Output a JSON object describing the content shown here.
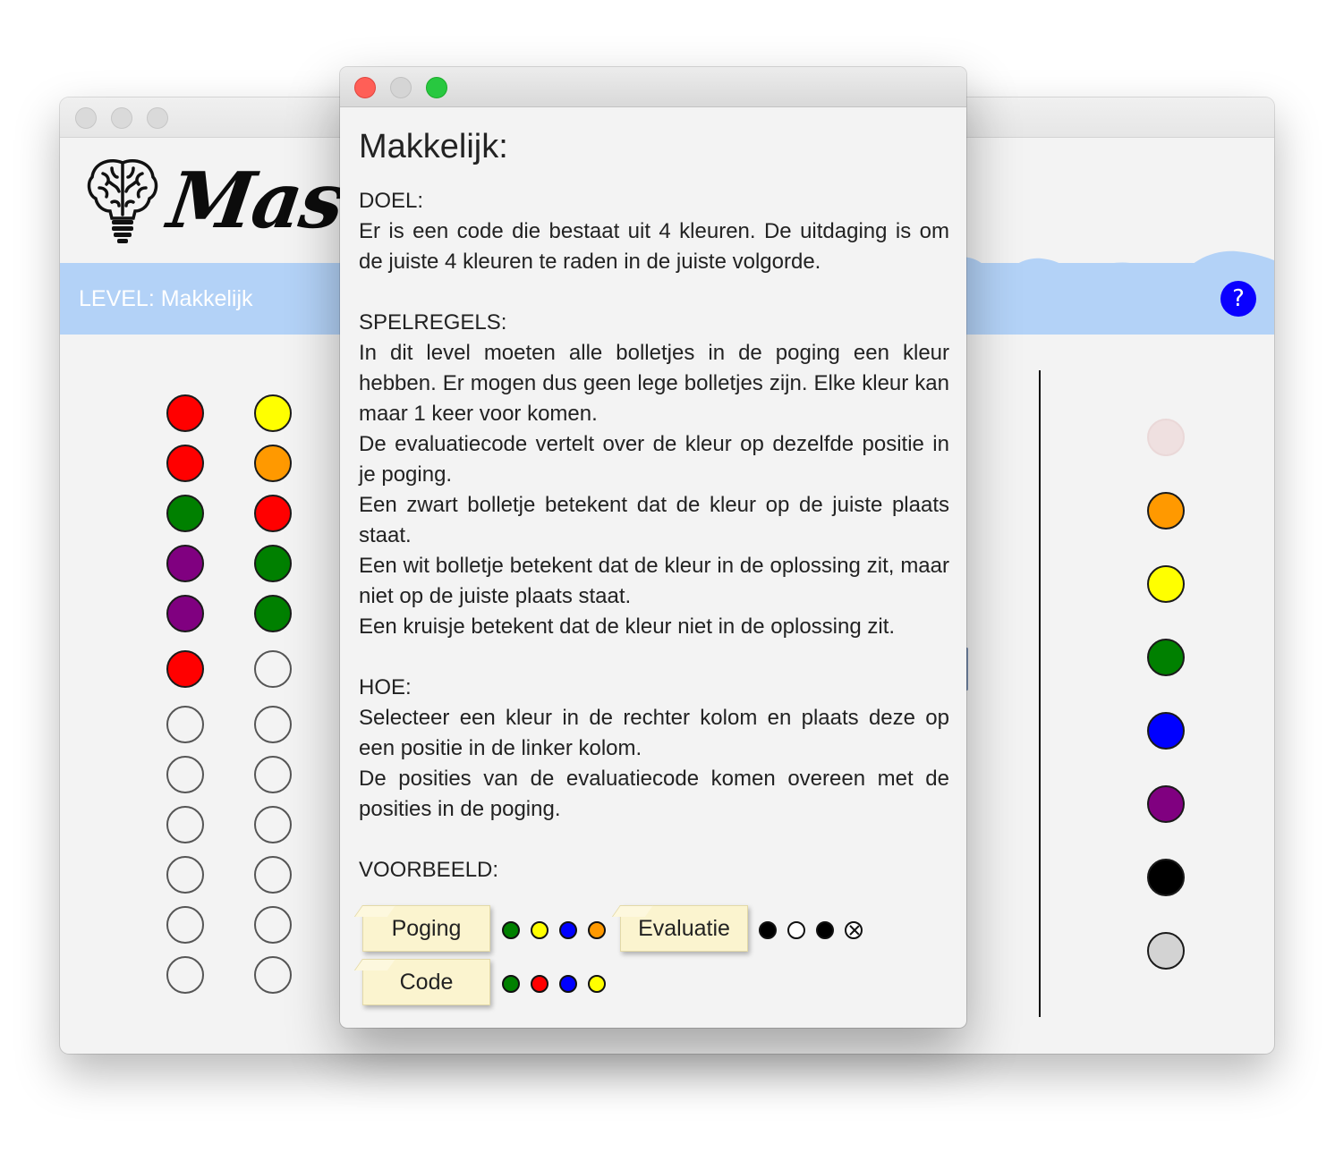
{
  "main_window": {
    "logo_text": "Mast",
    "level_label": "LEVEL: Makkelijk",
    "help_label": "?",
    "attempt_columns": [
      {
        "pegs": [
          "#ff0000",
          "#ff0000",
          "#008000",
          "#800080",
          "#800080",
          "#ff0000",
          "empty",
          "empty",
          "empty",
          "empty",
          "empty",
          "empty"
        ]
      },
      {
        "pegs": [
          "#ffff00",
          "#ff9900",
          "#ff0000",
          "#008000",
          "#008000",
          "empty",
          "empty",
          "empty",
          "empty",
          "empty",
          "empty",
          "empty"
        ]
      }
    ],
    "palette": [
      "faded",
      "#ff9900",
      "#ffff00",
      "#008000",
      "#0000ff",
      "#800080",
      "#000000",
      "#d3d3d3"
    ]
  },
  "dialog": {
    "title": "Makkelijk:",
    "doel_heading": "DOEL:",
    "doel_text": "Er is een code die bestaat uit 4 kleuren. De uitdaging is om de juiste 4 kleuren te raden in de juiste volgorde.",
    "spelregels_heading": "SPELREGELS:",
    "spelregels_lines": [
      "In dit level moeten alle bolletjes in de poging een kleur hebben. Er mogen dus geen lege bolletjes zijn. Elke kleur kan maar 1 keer voor komen.",
      "De evaluatiecode vertelt over de kleur op dezelfde positie in je poging.",
      "Een zwart bolletje betekent dat de kleur op de juiste plaats staat.",
      "Een wit bolletje betekent dat de kleur in de oplossing zit, maar niet op de juiste plaats staat.",
      "Een kruisje betekent dat de kleur niet in de oplossing zit."
    ],
    "hoe_heading": "HOE:",
    "hoe_lines": [
      "Selecteer een kleur in de rechter kolom en plaats deze op een positie in de linker kolom.",
      "De posities van de evaluatiecode komen overeen met de posities in de poging."
    ],
    "voorbeeld_heading": "VOORBEELD:",
    "example": {
      "poging_label": "Poging",
      "poging_dots": [
        "#008000",
        "#ffff00",
        "#0000ff",
        "#ff9900"
      ],
      "evaluatie_label": "Evaluatie",
      "evaluatie_dots": [
        "black",
        "white",
        "black",
        "cross"
      ],
      "code_label": "Code",
      "code_dots": [
        "#008000",
        "#ff0000",
        "#0000ff",
        "#ffff00"
      ]
    }
  }
}
